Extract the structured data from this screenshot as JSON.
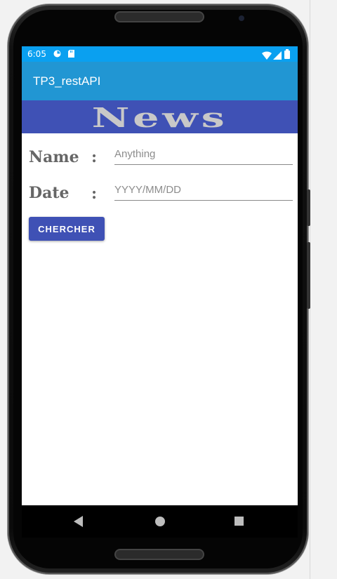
{
  "status_bar": {
    "time": "6:05",
    "icons": [
      "pie-icon",
      "sd-card-icon",
      "wifi-icon",
      "signal-icon",
      "battery-icon"
    ],
    "color": "#0aa0f0"
  },
  "app_bar": {
    "title": "TP3_restAPI",
    "color": "#2196d3"
  },
  "banner": {
    "text": "News",
    "color": "#3f51b5"
  },
  "form": {
    "name_label": "Name",
    "date_label": "Date",
    "colon": ":",
    "name_placeholder": "Anything",
    "date_placeholder": "YYYY/MM/DD",
    "search_button": "CHERCHER"
  },
  "nav_bar": {
    "icons": [
      "back-icon",
      "home-icon",
      "recents-icon"
    ]
  }
}
